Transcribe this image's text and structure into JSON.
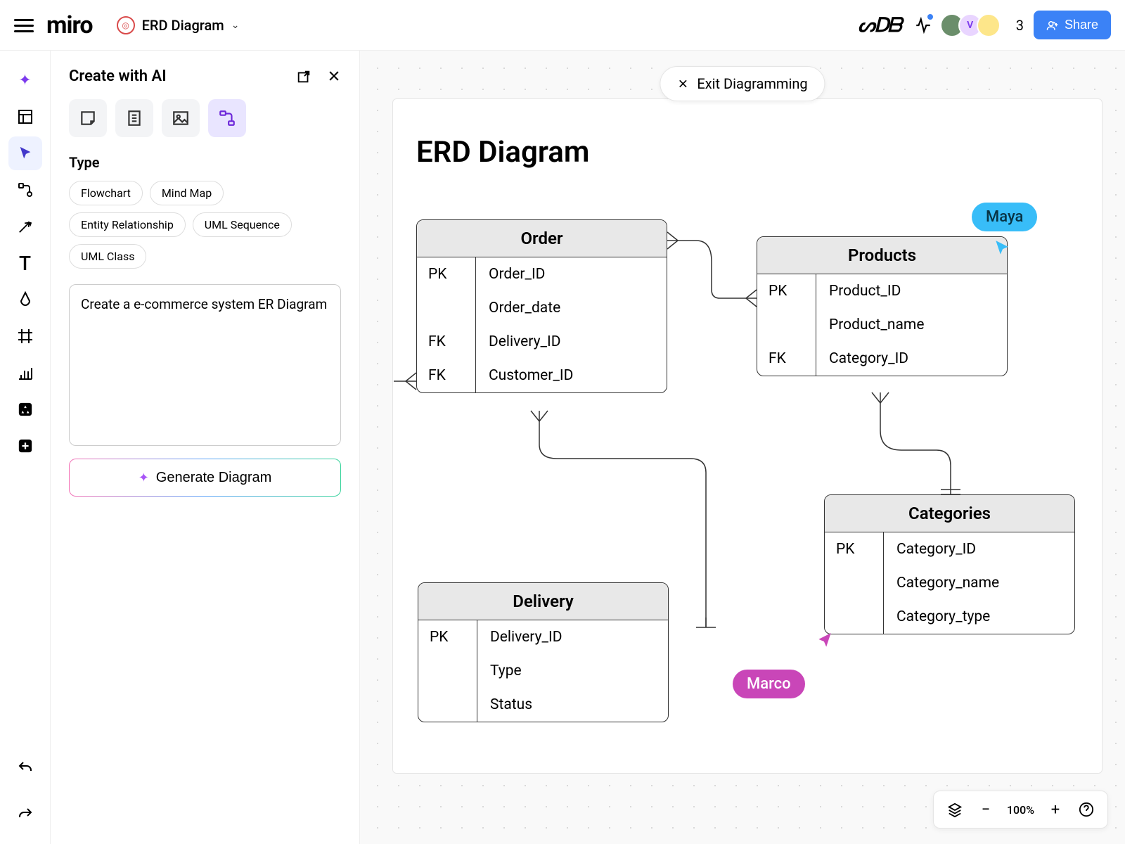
{
  "header": {
    "board_name": "ERD Diagram",
    "logo_text": "miro",
    "collaborator_count": "3",
    "share_label": "Share"
  },
  "ai_panel": {
    "title": "Create with AI",
    "type_label": "Type",
    "type_chips": [
      "Flowchart",
      "Mind Map",
      "Entity Relationship",
      "UML Sequence",
      "UML Class"
    ],
    "prompt_value": "Create a e-commerce system ER Diagram",
    "generate_label": "Generate Diagram"
  },
  "canvas": {
    "exit_label": "Exit Diagramming",
    "frame_title": "ERD Diagram",
    "entities": {
      "order": {
        "name": "Order",
        "rows": [
          {
            "key": "PK",
            "field": "Order_ID"
          },
          {
            "key": "",
            "field": "Order_date"
          },
          {
            "key": "FK",
            "field": "Delivery_ID"
          },
          {
            "key": "FK",
            "field": "Customer_ID"
          }
        ]
      },
      "products": {
        "name": "Products",
        "rows": [
          {
            "key": "PK",
            "field": "Product_ID"
          },
          {
            "key": "",
            "field": "Product_name"
          },
          {
            "key": "FK",
            "field": "Category_ID"
          }
        ]
      },
      "delivery": {
        "name": "Delivery",
        "rows": [
          {
            "key": "PK",
            "field": "Delivery_ID"
          },
          {
            "key": "",
            "field": "Type"
          },
          {
            "key": "",
            "field": "Status"
          }
        ]
      },
      "categories": {
        "name": "Categories",
        "rows": [
          {
            "key": "PK",
            "field": "Category_ID"
          },
          {
            "key": "",
            "field": "Category_name"
          },
          {
            "key": "",
            "field": "Category_type"
          }
        ]
      }
    },
    "collaborators": {
      "maya": "Maya",
      "marco": "Marco"
    }
  },
  "zoom": {
    "percent": "100%"
  }
}
